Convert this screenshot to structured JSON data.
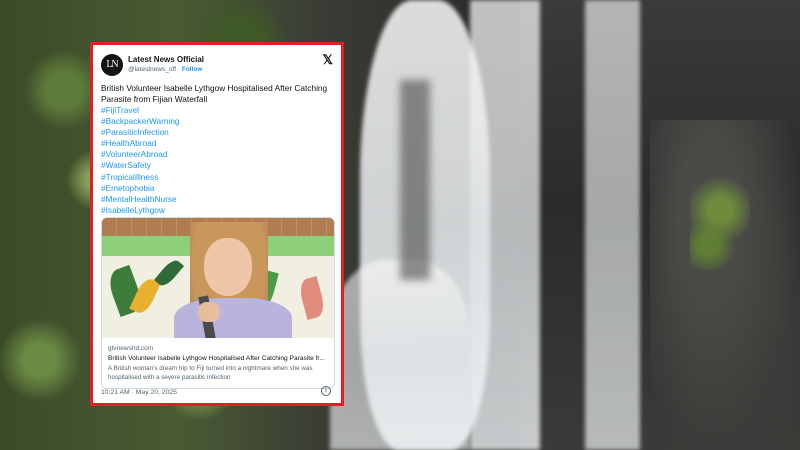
{
  "post": {
    "account_name": "Latest News Official",
    "avatar_initials": "LN",
    "handle": "@latestnews_off",
    "separator": "·",
    "follow_label": "Follow",
    "x_logo": "𝕏",
    "text": "British Volunteer Isabelle Lythgow Hospitalised After Catching Parasite from Fijian Waterfall",
    "hashtags": [
      "#FijiTravel",
      "#BackpackerWarning",
      "#ParasiticInfection",
      "#HealthAbroad",
      "#VolunteerAbroad",
      "#WaterSafety",
      "#TropicalIllness",
      "#Emetophobia",
      "#MentalHealthNurse",
      "#IsabelleLythgow"
    ],
    "link_card": {
      "domain": "gtvnewshd.com",
      "title": "British Volunteer Isabelle Lythgow Hospitalised After Catching Parasite fr...",
      "description": "A British woman's dream trip to Fiji turned into a nightmare when she was hospitalised with a severe parasitic infection"
    },
    "timestamp": "10:21 AM · May 20, 2025",
    "info_icon": "i"
  },
  "colors": {
    "frame_border": "#e31e24",
    "link_blue": "#1d9bf0",
    "text_primary": "#0f1419",
    "text_secondary": "#536471"
  }
}
